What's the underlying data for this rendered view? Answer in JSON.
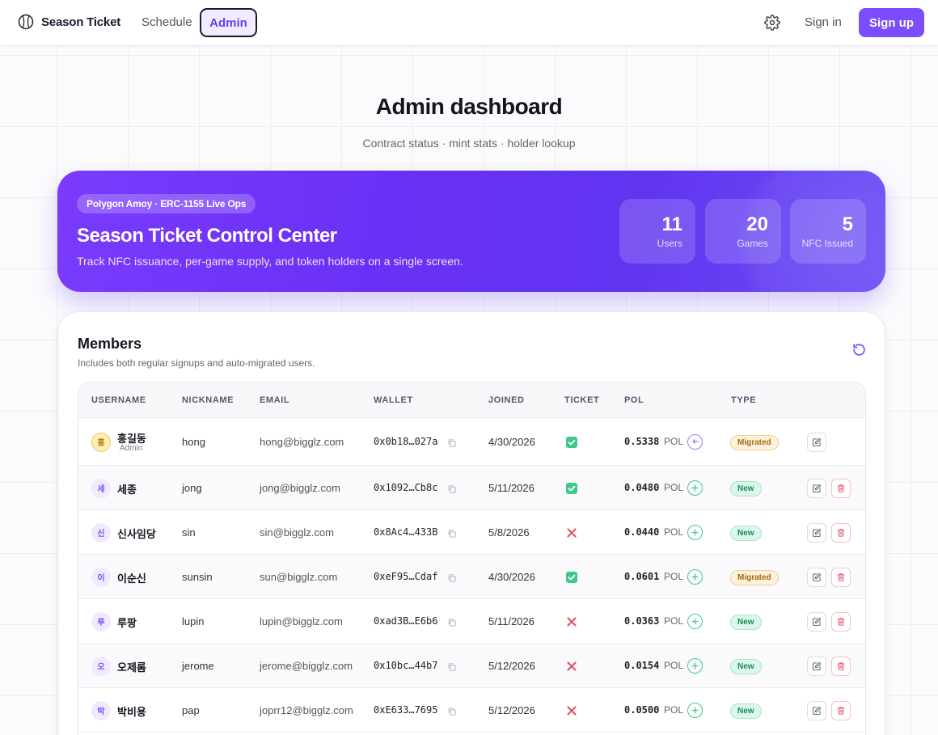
{
  "nav": {
    "brand": "Season Ticket",
    "links": [
      {
        "label": "Schedule"
      },
      {
        "label": "Admin",
        "active": true
      }
    ],
    "signin_label": "Sign in",
    "signup_label": "Sign up",
    "icons": {
      "brand": "baseball-icon",
      "settings": "gear-icon"
    }
  },
  "header": {
    "title": "Admin dashboard",
    "subtitle": "Contract status · mint stats · holder lookup"
  },
  "hero": {
    "pill": "Polygon Amoy · ERC-1155 Live Ops",
    "title": "Season Ticket Control Center",
    "subtitle": "Track NFC issuance, per-game supply, and token holders on a single screen.",
    "stats": [
      {
        "value": "11",
        "label": "Users"
      },
      {
        "value": "20",
        "label": "Games"
      },
      {
        "value": "5",
        "label": "NFC Issued"
      }
    ]
  },
  "members": {
    "title": "Members",
    "subtitle": "Includes both regular signups and auto-migrated users.",
    "refresh_icon": "refresh-icon",
    "columns": [
      "USERNAME",
      "NICKNAME",
      "EMAIL",
      "WALLET",
      "JOINED",
      "TICKET",
      "POL",
      "TYPE"
    ],
    "rows": [
      {
        "initial": "홍",
        "username": "홍길동",
        "role": "Admin",
        "nickname": "hong",
        "email": "hong@bigglz.com",
        "wallet": "0x0b18…027a",
        "joined": "4/30/2026",
        "ticket": true,
        "pol": "0.5338",
        "pol_unit": "POL",
        "pol_action": "minus",
        "type": "Migrated",
        "deletable": false
      },
      {
        "initial": "세",
        "username": "세종",
        "role": "",
        "nickname": "jong",
        "email": "jong@bigglz.com",
        "wallet": "0x1092…Cb8c",
        "joined": "5/11/2026",
        "ticket": true,
        "pol": "0.0480",
        "pol_unit": "POL",
        "pol_action": "plus",
        "type": "New",
        "deletable": true
      },
      {
        "initial": "신",
        "username": "신사임당",
        "role": "",
        "nickname": "sin",
        "email": "sin@bigglz.com",
        "wallet": "0x8Ac4…433B",
        "joined": "5/8/2026",
        "ticket": false,
        "pol": "0.0440",
        "pol_unit": "POL",
        "pol_action": "plus",
        "type": "New",
        "deletable": true
      },
      {
        "initial": "이",
        "username": "이순신",
        "role": "",
        "nickname": "sunsin",
        "email": "sun@bigglz.com",
        "wallet": "0xeF95…Cdaf",
        "joined": "4/30/2026",
        "ticket": true,
        "pol": "0.0601",
        "pol_unit": "POL",
        "pol_action": "plus",
        "type": "Migrated",
        "deletable": true
      },
      {
        "initial": "루",
        "username": "루팡",
        "role": "",
        "nickname": "lupin",
        "email": "lupin@bigglz.com",
        "wallet": "0xad3B…E6b6",
        "joined": "5/11/2026",
        "ticket": false,
        "pol": "0.0363",
        "pol_unit": "POL",
        "pol_action": "plus",
        "type": "New",
        "deletable": true
      },
      {
        "initial": "오",
        "username": "오제롬",
        "role": "",
        "nickname": "jerome",
        "email": "jerome@bigglz.com",
        "wallet": "0x10bc…44b7",
        "joined": "5/12/2026",
        "ticket": false,
        "pol": "0.0154",
        "pol_unit": "POL",
        "pol_action": "plus",
        "type": "New",
        "deletable": true
      },
      {
        "initial": "박",
        "username": "박비용",
        "role": "",
        "nickname": "pap",
        "email": "joprr12@bigglz.com",
        "wallet": "0xE633…7695",
        "joined": "5/12/2026",
        "ticket": false,
        "pol": "0.0500",
        "pol_unit": "POL",
        "pol_action": "plus",
        "type": "New",
        "deletable": true
      }
    ]
  },
  "colors": {
    "accent": "#7c4dff",
    "success": "#3ec98a",
    "danger": "#e8536b",
    "warning": "#a76a10"
  }
}
